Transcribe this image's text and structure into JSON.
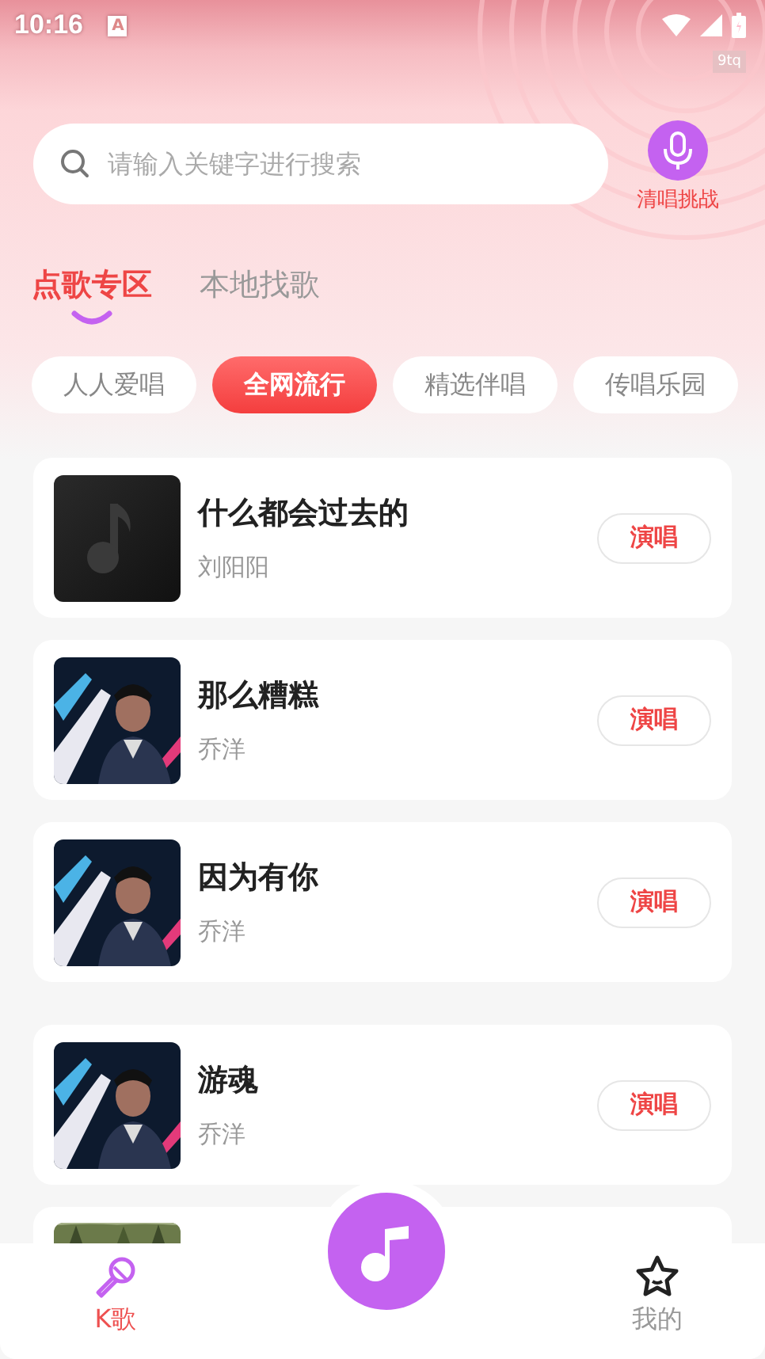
{
  "status_bar": {
    "time": "10:16",
    "notification": "A",
    "overlay_tag": "9tq"
  },
  "search": {
    "placeholder": "请输入关键字进行搜索"
  },
  "voice_button": {
    "label": "清唱挑战"
  },
  "tabs": [
    {
      "label": "点歌专区",
      "selected": true
    },
    {
      "label": "本地找歌",
      "selected": false
    }
  ],
  "chips": [
    {
      "label": "人人爱唱",
      "selected": false
    },
    {
      "label": "全网流行",
      "selected": true
    },
    {
      "label": "精选伴唱",
      "selected": false
    },
    {
      "label": "传唱乐园",
      "selected": false
    }
  ],
  "songs": [
    {
      "title": "什么都会过去的",
      "artist": "刘阳阳",
      "action": "演唱",
      "cover": {
        "kind": "placeholder"
      }
    },
    {
      "title": "那么糟糕",
      "artist": "乔洋",
      "action": "演唱"
    },
    {
      "title": "因为有你",
      "artist": "乔洋",
      "action": "演唱"
    },
    {
      "title": "游魂",
      "artist": "乔洋",
      "action": "演唱"
    },
    {
      "cover": {
        "kind": "landscape"
      }
    }
  ],
  "bottom_nav": [
    {
      "label": "K歌",
      "selected": true,
      "kind": "mic"
    },
    {
      "kind": "center"
    },
    {
      "label": "我的",
      "selected": false,
      "kind": "star"
    }
  ]
}
